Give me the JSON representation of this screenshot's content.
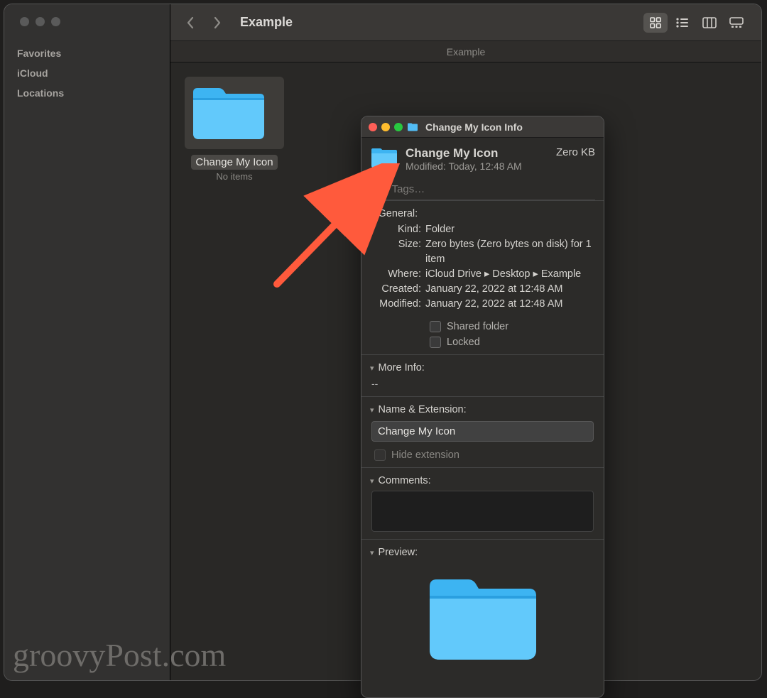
{
  "finder": {
    "sidebar": {
      "favorites": "Favorites",
      "icloud": "iCloud",
      "locations": "Locations"
    },
    "toolbar_title": "Example",
    "path_bar": "Example",
    "item": {
      "name": "Change My Icon",
      "subtitle": "No items"
    }
  },
  "info": {
    "window_title": "Change My Icon Info",
    "header": {
      "name": "Change My Icon",
      "modified_label": "Modified:",
      "modified_value": "Today, 12:48 AM",
      "size": "Zero KB"
    },
    "tags_placeholder": "Add Tags…",
    "sections": {
      "general": "General:",
      "more_info": "More Info:",
      "name_ext": "Name & Extension:",
      "comments": "Comments:",
      "preview": "Preview:"
    },
    "general": {
      "kind_label": "Kind:",
      "kind_value": "Folder",
      "size_label": "Size:",
      "size_value": "Zero bytes (Zero bytes on disk) for 1 item",
      "where_label": "Where:",
      "where_value": "iCloud Drive ▸ Desktop ▸ Example",
      "created_label": "Created:",
      "created_value": "January 22, 2022 at 12:48 AM",
      "modified_label": "Modified:",
      "modified_value": "January 22, 2022 at 12:48 AM",
      "shared_label": "Shared folder",
      "locked_label": "Locked"
    },
    "more_info_value": "--",
    "name_ext_value": "Change My Icon",
    "hide_ext_label": "Hide extension"
  },
  "watermark": "groovyPost.com"
}
